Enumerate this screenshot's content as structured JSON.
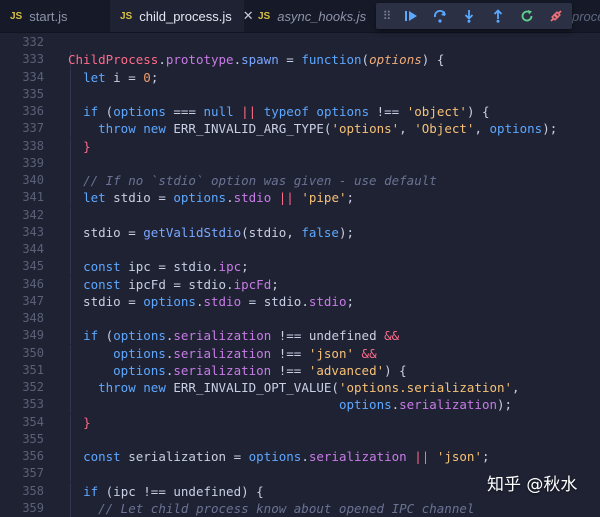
{
  "tabs": [
    {
      "badge": "JS",
      "name": "start.js",
      "active": false,
      "italic": false
    },
    {
      "badge": "JS",
      "name": "child_process.js",
      "active": true,
      "italic": false
    },
    {
      "badge": "JS",
      "name": "async_hooks.js",
      "active": false,
      "italic": true
    }
  ],
  "overflow_tab": "proces",
  "debug_toolbar": [
    "drag-grip",
    "continue",
    "step-over",
    "step-into",
    "step-out",
    "restart",
    "disconnect"
  ],
  "colors": {
    "background": "#1e2233",
    "keyword": "#5ea8ff",
    "string": "#f6c177",
    "property": "#c87ce6",
    "class": "#ff6b8a"
  },
  "lines": [
    {
      "n": "332",
      "tokens": []
    },
    {
      "n": "333",
      "tokens": [
        [
          "ChildProcess",
          "cls"
        ],
        [
          ".",
          "pl"
        ],
        [
          "prototype",
          "prop"
        ],
        [
          ".",
          "pl"
        ],
        [
          "spawn",
          "fn"
        ],
        [
          " = ",
          "pl"
        ],
        [
          "function",
          "kw"
        ],
        [
          "(",
          "pl"
        ],
        [
          "options",
          "param"
        ],
        [
          ") {",
          "pl"
        ]
      ]
    },
    {
      "n": "334",
      "tokens": [
        [
          "  ",
          "pl"
        ],
        [
          "let",
          "kw"
        ],
        [
          " i = ",
          "pl"
        ],
        [
          "0",
          "num"
        ],
        [
          ";",
          "pl"
        ]
      ]
    },
    {
      "n": "335",
      "tokens": []
    },
    {
      "n": "336",
      "tokens": [
        [
          "  ",
          "pl"
        ],
        [
          "if",
          "kw"
        ],
        [
          " (",
          "pl"
        ],
        [
          "options",
          "kw"
        ],
        [
          " === ",
          "pl"
        ],
        [
          "null",
          "kw"
        ],
        [
          " || ",
          "op"
        ],
        [
          "typeof",
          "kw"
        ],
        [
          " ",
          "pl"
        ],
        [
          "options",
          "kw"
        ],
        [
          " !== ",
          "pl"
        ],
        [
          "'object'",
          "str"
        ],
        [
          ") {",
          "pl"
        ]
      ]
    },
    {
      "n": "337",
      "tokens": [
        [
          "    ",
          "pl"
        ],
        [
          "throw",
          "kw"
        ],
        [
          " ",
          "pl"
        ],
        [
          "new",
          "kw"
        ],
        [
          " ERR_INVALID_ARG_TYPE(",
          "pl"
        ],
        [
          "'options'",
          "str"
        ],
        [
          ", ",
          "pl"
        ],
        [
          "'Object'",
          "str"
        ],
        [
          ", ",
          "pl"
        ],
        [
          "options",
          "kw"
        ],
        [
          ");",
          "pl"
        ]
      ]
    },
    {
      "n": "338",
      "tokens": [
        [
          "  ",
          "pl"
        ],
        [
          "}",
          "op"
        ]
      ]
    },
    {
      "n": "339",
      "tokens": []
    },
    {
      "n": "340",
      "tokens": [
        [
          "  ",
          "pl"
        ],
        [
          "// If no `stdio` option was given - use default",
          "com"
        ]
      ]
    },
    {
      "n": "341",
      "tokens": [
        [
          "  ",
          "pl"
        ],
        [
          "let",
          "kw"
        ],
        [
          " stdio = ",
          "pl"
        ],
        [
          "options",
          "kw"
        ],
        [
          ".",
          "pl"
        ],
        [
          "stdio",
          "prop"
        ],
        [
          " || ",
          "op"
        ],
        [
          "'pipe'",
          "str"
        ],
        [
          ";",
          "pl"
        ]
      ]
    },
    {
      "n": "342",
      "tokens": []
    },
    {
      "n": "343",
      "tokens": [
        [
          "  stdio = ",
          "pl"
        ],
        [
          "getValidStdio",
          "fn"
        ],
        [
          "(stdio, ",
          "pl"
        ],
        [
          "false",
          "kw"
        ],
        [
          ");",
          "pl"
        ]
      ]
    },
    {
      "n": "344",
      "tokens": []
    },
    {
      "n": "345",
      "tokens": [
        [
          "  ",
          "pl"
        ],
        [
          "const",
          "kw"
        ],
        [
          " ipc = stdio.",
          "pl"
        ],
        [
          "ipc",
          "prop"
        ],
        [
          ";",
          "pl"
        ]
      ]
    },
    {
      "n": "346",
      "tokens": [
        [
          "  ",
          "pl"
        ],
        [
          "const",
          "kw"
        ],
        [
          " ipcFd = stdio.",
          "pl"
        ],
        [
          "ipcFd",
          "prop"
        ],
        [
          ";",
          "pl"
        ]
      ]
    },
    {
      "n": "347",
      "tokens": [
        [
          "  stdio = ",
          "pl"
        ],
        [
          "options",
          "kw"
        ],
        [
          ".",
          "pl"
        ],
        [
          "stdio",
          "prop"
        ],
        [
          " = stdio.",
          "pl"
        ],
        [
          "stdio",
          "prop"
        ],
        [
          ";",
          "pl"
        ]
      ]
    },
    {
      "n": "348",
      "tokens": []
    },
    {
      "n": "349",
      "tokens": [
        [
          "  ",
          "pl"
        ],
        [
          "if",
          "kw"
        ],
        [
          " (",
          "pl"
        ],
        [
          "options",
          "kw"
        ],
        [
          ".",
          "pl"
        ],
        [
          "serialization",
          "prop"
        ],
        [
          " !== undefined ",
          "pl"
        ],
        [
          "&&",
          "op"
        ]
      ]
    },
    {
      "n": "350",
      "tokens": [
        [
          "      ",
          "pl"
        ],
        [
          "options",
          "kw"
        ],
        [
          ".",
          "pl"
        ],
        [
          "serialization",
          "prop"
        ],
        [
          " !== ",
          "pl"
        ],
        [
          "'json'",
          "str"
        ],
        [
          " ",
          "pl"
        ],
        [
          "&&",
          "op"
        ]
      ]
    },
    {
      "n": "351",
      "tokens": [
        [
          "      ",
          "pl"
        ],
        [
          "options",
          "kw"
        ],
        [
          ".",
          "pl"
        ],
        [
          "serialization",
          "prop"
        ],
        [
          " !== ",
          "pl"
        ],
        [
          "'advanced'",
          "str"
        ],
        [
          ") {",
          "pl"
        ]
      ]
    },
    {
      "n": "352",
      "tokens": [
        [
          "    ",
          "pl"
        ],
        [
          "throw",
          "kw"
        ],
        [
          " ",
          "pl"
        ],
        [
          "new",
          "kw"
        ],
        [
          " ERR_INVALID_OPT_VALUE(",
          "pl"
        ],
        [
          "'options.serialization'",
          "str"
        ],
        [
          ",",
          "pl"
        ]
      ]
    },
    {
      "n": "353",
      "tokens": [
        [
          "                                    ",
          "pl"
        ],
        [
          "options",
          "kw"
        ],
        [
          ".",
          "pl"
        ],
        [
          "serialization",
          "prop"
        ],
        [
          ");",
          "pl"
        ]
      ]
    },
    {
      "n": "354",
      "tokens": [
        [
          "  ",
          "pl"
        ],
        [
          "}",
          "op"
        ]
      ]
    },
    {
      "n": "355",
      "tokens": []
    },
    {
      "n": "356",
      "tokens": [
        [
          "  ",
          "pl"
        ],
        [
          "const",
          "kw"
        ],
        [
          " serialization = ",
          "pl"
        ],
        [
          "options",
          "kw"
        ],
        [
          ".",
          "pl"
        ],
        [
          "serialization",
          "prop"
        ],
        [
          " || ",
          "op"
        ],
        [
          "'json'",
          "str"
        ],
        [
          ";",
          "pl"
        ]
      ]
    },
    {
      "n": "357",
      "tokens": []
    },
    {
      "n": "358",
      "tokens": [
        [
          "  ",
          "pl"
        ],
        [
          "if",
          "kw"
        ],
        [
          " (ipc !== undefined) {",
          "pl"
        ]
      ]
    },
    {
      "n": "359",
      "tokens": [
        [
          "    ",
          "pl"
        ],
        [
          "// Let child process know about opened IPC channel",
          "com"
        ]
      ]
    }
  ],
  "watermark": "知乎 @秋水"
}
